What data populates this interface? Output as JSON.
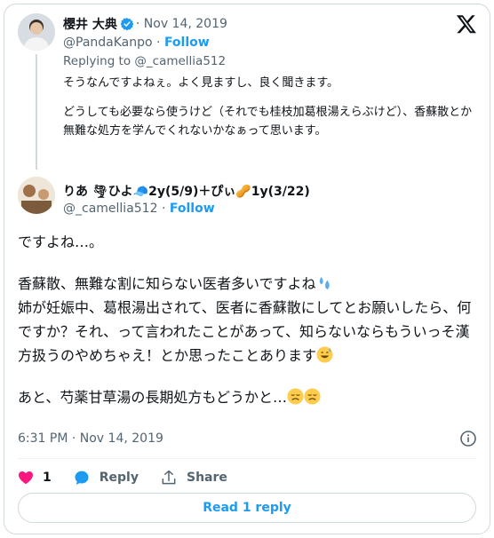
{
  "parent_tweet": {
    "display_name": "櫻井 大典",
    "date": "· Nov 14, 2019",
    "handle": "@PandaKanpo",
    "separator": "·",
    "follow_label": "Follow",
    "replying_to": "Replying to @_camellia512",
    "text_p1": "そうなんですよねぇ。よく見ますし、良く聞きます。",
    "text_p2": "どうしても必要なら使うけど（それでも桂枝加葛根湯えらぶけど）、香蘇散とか無難な処方を学んでくれないかなぁって思います。"
  },
  "reply_tweet": {
    "display_name": "りあ 🌪ひよ🧢2y(5/9)＋ぴぃ🥜1y(3/22)",
    "handle": "@_camellia512",
    "separator": "·",
    "follow_label": "Follow",
    "text_p1": "ですよね…。",
    "text_p2_line1": "香蘇散、無難な割に知らない医者多いですよね",
    "text_p2_rest": "姉が妊娠中、葛根湯出されて、医者に香蘇散にしてとお願いしたら、何ですか？それ、って言われたことがあって、知らないならもういっそ漢方扱うのやめちゃえ！とか思ったことあります",
    "text_p3": "あと、芍薬甘草湯の長期処方もどうかと…",
    "timestamp": "6:31 PM · Nov 14, 2019",
    "like_count": "1",
    "reply_label": "Reply",
    "share_label": "Share",
    "read_replies_label": "Read 1 reply"
  },
  "icons": {
    "platform": "x-logo-icon",
    "verified": "verified-badge-icon",
    "info": "info-icon",
    "like": "heart-icon",
    "reply": "reply-bubble-icon",
    "share": "share-icon",
    "emoji_sweat": "sweat-droplets-emoji",
    "emoji_grin_sweat": "grinning-sweat-emoji",
    "emoji_disappointed": "disappointed-face-emoji"
  },
  "colors": {
    "accent": "#1d9bf0",
    "like": "#f91880",
    "text_primary": "#0f1419",
    "text_secondary": "#536471"
  }
}
